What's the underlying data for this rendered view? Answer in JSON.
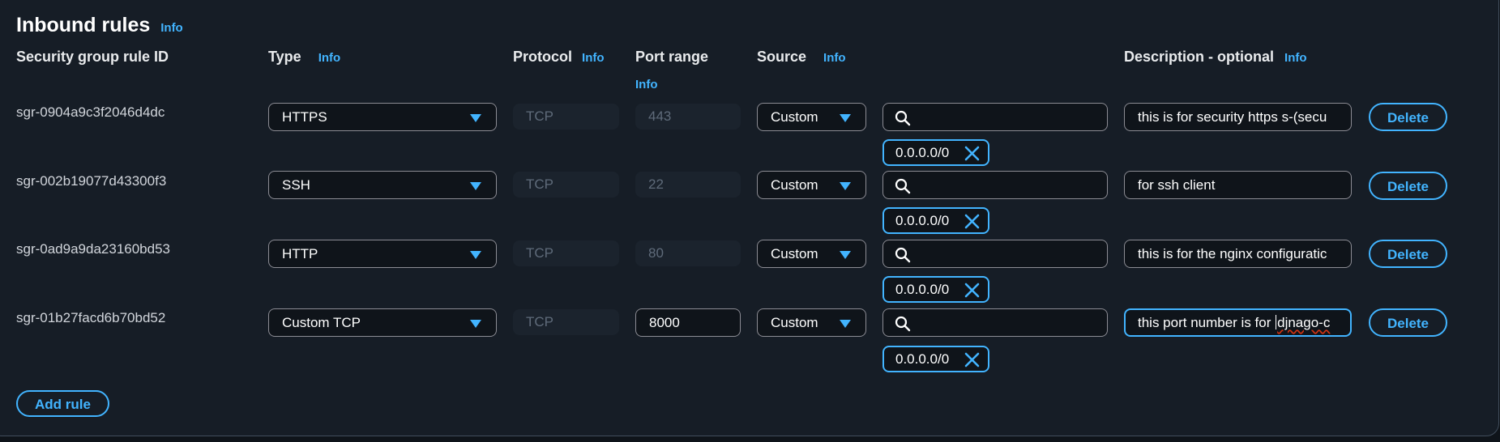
{
  "title": "Inbound rules",
  "info_label": "Info",
  "headers": {
    "rule_id": "Security group rule ID",
    "type": "Type",
    "protocol": "Protocol",
    "port_range": "Port range",
    "source": "Source",
    "description": "Description - optional"
  },
  "rules": [
    {
      "id": "sgr-0904a9c3f2046d4dc",
      "type": "HTTPS",
      "protocol": "TCP",
      "port": "443",
      "port_editable": false,
      "source": "Custom",
      "search_value": "",
      "cidr": "0.0.0.0/0",
      "description": "this is for security https  s-(secu",
      "description_focused": false
    },
    {
      "id": "sgr-002b19077d43300f3",
      "type": "SSH",
      "protocol": "TCP",
      "port": "22",
      "port_editable": false,
      "source": "Custom",
      "search_value": "",
      "cidr": "0.0.0.0/0",
      "description": "for ssh client",
      "description_focused": false
    },
    {
      "id": "sgr-0ad9a9da23160bd53",
      "type": "HTTP",
      "protocol": "TCP",
      "port": "80",
      "port_editable": false,
      "source": "Custom",
      "search_value": "",
      "cidr": "0.0.0.0/0",
      "description": "this is for the nginx configuratic",
      "description_focused": false
    },
    {
      "id": "sgr-01b27facd6b70bd52",
      "type": "Custom TCP",
      "protocol": "TCP",
      "port": "8000",
      "port_editable": true,
      "source": "Custom",
      "search_value": "",
      "cidr": "0.0.0.0/0",
      "description_before_cursor": "this port number is for ",
      "description_after_cursor": "djnago-c",
      "description_focused": true
    }
  ],
  "delete_label": "Delete",
  "add_rule_label": "Add rule",
  "colors": {
    "accent": "#42b4ff",
    "panel_bg": "#161d26",
    "page_bg": "#0f141a",
    "border": "#8c8c94",
    "disabled_text": "#5f6b7a"
  }
}
